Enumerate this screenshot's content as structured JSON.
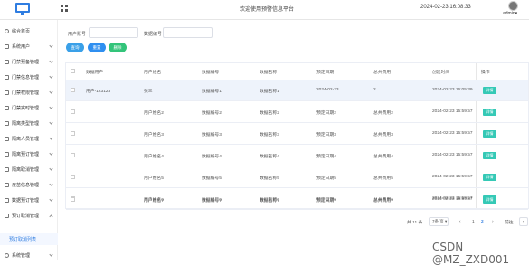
{
  "header": {
    "site_title": "欢迎使用预警信息平台",
    "datetime": "2024-02-23 16:08:33",
    "user": "admin"
  },
  "sidebar": {
    "items": [
      {
        "label": "综合首页",
        "icon": "dashboard-icon"
      },
      {
        "label": "系统用户",
        "icon": "user-icon"
      },
      {
        "label": "门禁预备管理",
        "icon": "folder-icon"
      },
      {
        "label": "门禁信息管理",
        "icon": "folder-icon"
      },
      {
        "label": "门禁权限管理",
        "icon": "folder-icon"
      },
      {
        "label": "门禁实时管理",
        "icon": "folder-icon"
      },
      {
        "label": "隔离类型管理",
        "icon": "folder-icon"
      },
      {
        "label": "隔离人员管理",
        "icon": "folder-icon"
      },
      {
        "label": "隔离预订管理",
        "icon": "folder-icon"
      },
      {
        "label": "隔离取消管理",
        "icon": "folder-icon"
      },
      {
        "label": "疫苗信息管理",
        "icon": "folder-icon"
      },
      {
        "label": "数据预订管理",
        "icon": "folder-icon"
      },
      {
        "label": "预订取消管理",
        "icon": "folder-icon"
      },
      {
        "label": "预订取消列表",
        "icon": ""
      },
      {
        "label": "系统管理",
        "icon": "gear-icon"
      }
    ]
  },
  "search": {
    "field1_label": "用户账号",
    "field2_label": "数据编号"
  },
  "toolbar": {
    "search_label": "查询",
    "reset_label": "重置",
    "delete_label": "删除"
  },
  "table": {
    "headers": [
      "数据用户",
      "用户姓名",
      "数据编号",
      "数据名称",
      "预定日期",
      "总共费用",
      "创建时间",
      "操作"
    ],
    "rows": [
      [
        "用户-123123",
        "张三",
        "数据编号1",
        "数据名称1",
        "2024-02-23",
        "2",
        "2024-02-23 16:05:39"
      ],
      [
        "",
        "用户姓名2",
        "数据编号2",
        "数据名称2",
        "预定日期2",
        "总共费用2",
        "2024-02-23 15:59:57"
      ],
      [
        "",
        "用户姓名3",
        "数据编号3",
        "数据名称3",
        "预定日期3",
        "总共费用3",
        "2024-02-23 15:59:57"
      ],
      [
        "",
        "用户姓名4",
        "数据编号4",
        "数据名称4",
        "预定日期4",
        "总共费用4",
        "2024-02-23 15:59:57"
      ],
      [
        "",
        "用户姓名5",
        "数据编号5",
        "数据名称5",
        "预定日期5",
        "总共费用5",
        "2024-02-23 15:59:57"
      ],
      [
        "",
        "用户姓名6",
        "数据编号6",
        "数据名称6",
        "预定日期6",
        "总共费用6",
        "2024-02-23 15:59:57"
      ],
      [
        "",
        "用户姓名7",
        "数据编号7",
        "数据名称7",
        "预定日期7",
        "总共费用7",
        "2024-02-23 15:59:57"
      ]
    ],
    "row_action_label": "详情"
  },
  "pagination": {
    "total": "共 11 条",
    "page_size": "7条/页",
    "page1": "1",
    "page2": "2",
    "goto_label": "前往",
    "goto_value": "1"
  },
  "watermark": "CSDN @MZ_ZXD001",
  "colors": {
    "accent": "#2f7de1",
    "search_btn": "#3aa0e8",
    "reset_btn": "#2f8ff0",
    "delete_btn": "#33c47a",
    "detail_btn": "#35c9b6"
  }
}
